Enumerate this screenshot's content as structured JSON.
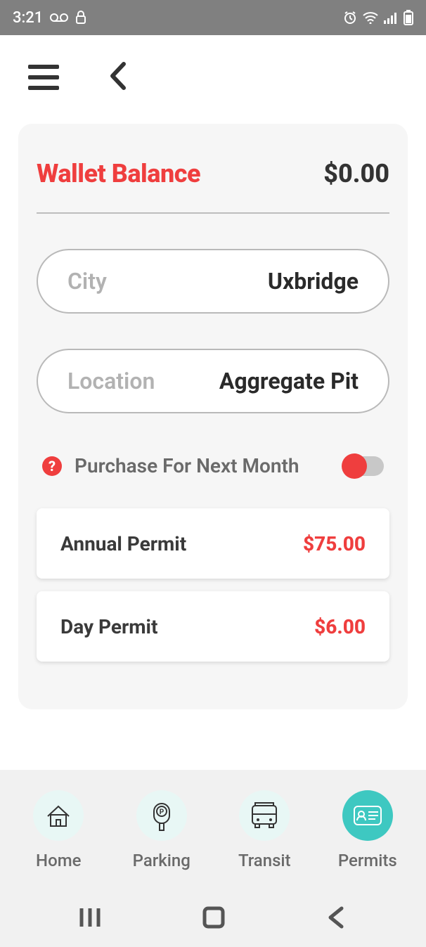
{
  "status": {
    "time": "3:21"
  },
  "wallet": {
    "title": "Wallet Balance",
    "amount": "$0.00"
  },
  "selectors": {
    "city": {
      "label": "City",
      "value": "Uxbridge"
    },
    "location": {
      "label": "Location",
      "value": "Aggregate Pit"
    }
  },
  "toggle": {
    "label": "Purchase For Next Month",
    "on": false
  },
  "permits": [
    {
      "name": "Annual Permit",
      "price": "$75.00"
    },
    {
      "name": "Day Permit",
      "price": "$6.00"
    }
  ],
  "tabs": {
    "home": "Home",
    "parking": "Parking",
    "transit": "Transit",
    "permits": "Permits"
  }
}
